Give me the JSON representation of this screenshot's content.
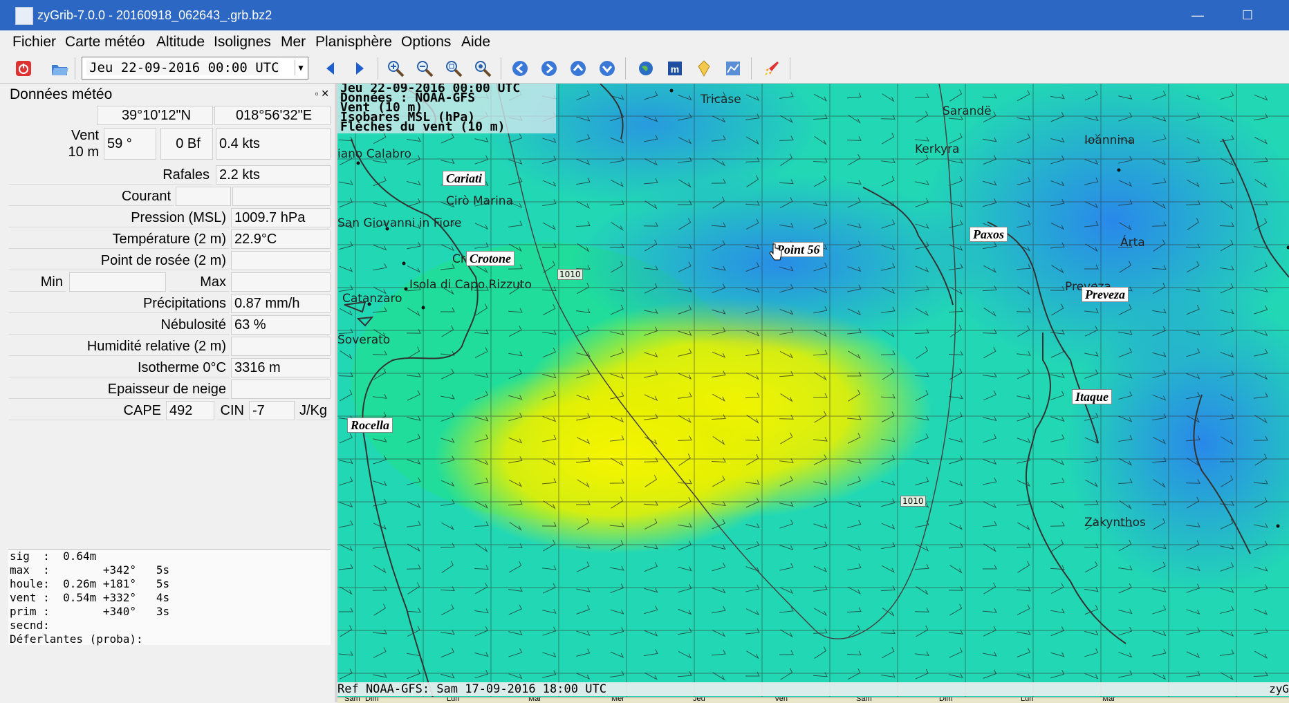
{
  "window": {
    "title": "zyGrib-7.0.0 - 20160918_062643_.grb.bz2"
  },
  "menu": [
    "Fichier",
    "Carte météo",
    "Altitude",
    "Isolignes",
    "Mer",
    "Planisphère",
    "Options",
    "Aide"
  ],
  "toolbar": {
    "date": "Jeu 22-09-2016 00:00 UTC",
    "icons": [
      "quit-icon",
      "open-file-icon",
      "prev-icon",
      "next-icon",
      "zoom-in-icon",
      "zoom-out-icon",
      "zoom-fit-icon",
      "zoom-all-icon",
      "pan-left-icon",
      "pan-right-icon",
      "pan-up-icon",
      "pan-down-icon",
      "globe-icon",
      "meteotable-icon",
      "poi-icon",
      "meteogram-icon",
      "rocket-icon"
    ]
  },
  "panel": {
    "title": "Données météo",
    "lat": "39°10'12\"N",
    "lon": "018°56'32\"E",
    "wind_label_1": "Vent",
    "wind_label_2": "10 m",
    "wind_dir": "59 °",
    "wind_bf": "0 Bf",
    "wind_speed": "0.4  kts",
    "gust_label": "Rafales",
    "gust_value": "2.2  kts",
    "current_label": "Courant",
    "pressure_label": "Pression (MSL)",
    "pressure_value": "1009.7 hPa",
    "temp_label": "Température (2 m)",
    "temp_value": "22.9°C",
    "dew_label": "Point de rosée (2 m)",
    "min_label": "Min",
    "max_label": "Max",
    "precip_label": "Précipitations",
    "precip_value": "0.87 mm/h",
    "cloud_label": "Nébulosité",
    "cloud_value": "63 %",
    "humid_label": "Humidité relative (2 m)",
    "iso_label": "Isotherme 0°C",
    "iso_value": "3316 m",
    "snow_label": "Epaisseur de neige",
    "cape_label": "CAPE",
    "cape_value": "492",
    "cin_label": "CIN",
    "cin_value": "-7",
    "cape_unit": "J/Kg",
    "swell_lines": [
      "sig  :  0.64m",
      "max  :        +342°   5s",
      "houle:  0.26m +181°   5s",
      "vent :  0.54m +332°   4s",
      "prim :        +340°   3s",
      "secnd:",
      "Déferlantes (proba):"
    ]
  },
  "map": {
    "header_lines": [
      "Jeu 22-09-2016 00:00 UTC",
      "Données : NOAA-GFS",
      "Vent (10 m)",
      "Isobares MSL (hPa)",
      "Flèches du vent (10 m)"
    ],
    "ref": "Ref NOAA-GFS: Sam 17-09-2016 18:00 UTC",
    "cities": [
      "Tricase",
      "Sarandë",
      "Kerkyra",
      "Ioánnina",
      "iano Calabro",
      "Cirò Marina",
      "San Giovanni in Fiore",
      "Cro",
      "Isola di Capo Rizzuto",
      "Catanzaro",
      "Soverato",
      "Árta",
      "Preveza",
      "Zakynthos"
    ],
    "pois": [
      "Cariati",
      "Crotone",
      "Point 56",
      "Paxos",
      "Preveza",
      "Itaque",
      "Rocella"
    ],
    "isobar_labels": [
      "1010",
      "1010"
    ],
    "corner_text": "zyG",
    "timeline_days": [
      "Sam",
      "Dim",
      "Lun",
      "Mar",
      "Mer",
      "Jeu",
      "Ven",
      "Sam",
      "Dim",
      "Lun",
      "Mar"
    ]
  },
  "colors": {
    "titlebar": "#2c67c4",
    "wind_low": "#2a7ff0",
    "wind_mid": "#1fe0b0",
    "wind_high": "#f2f000"
  }
}
